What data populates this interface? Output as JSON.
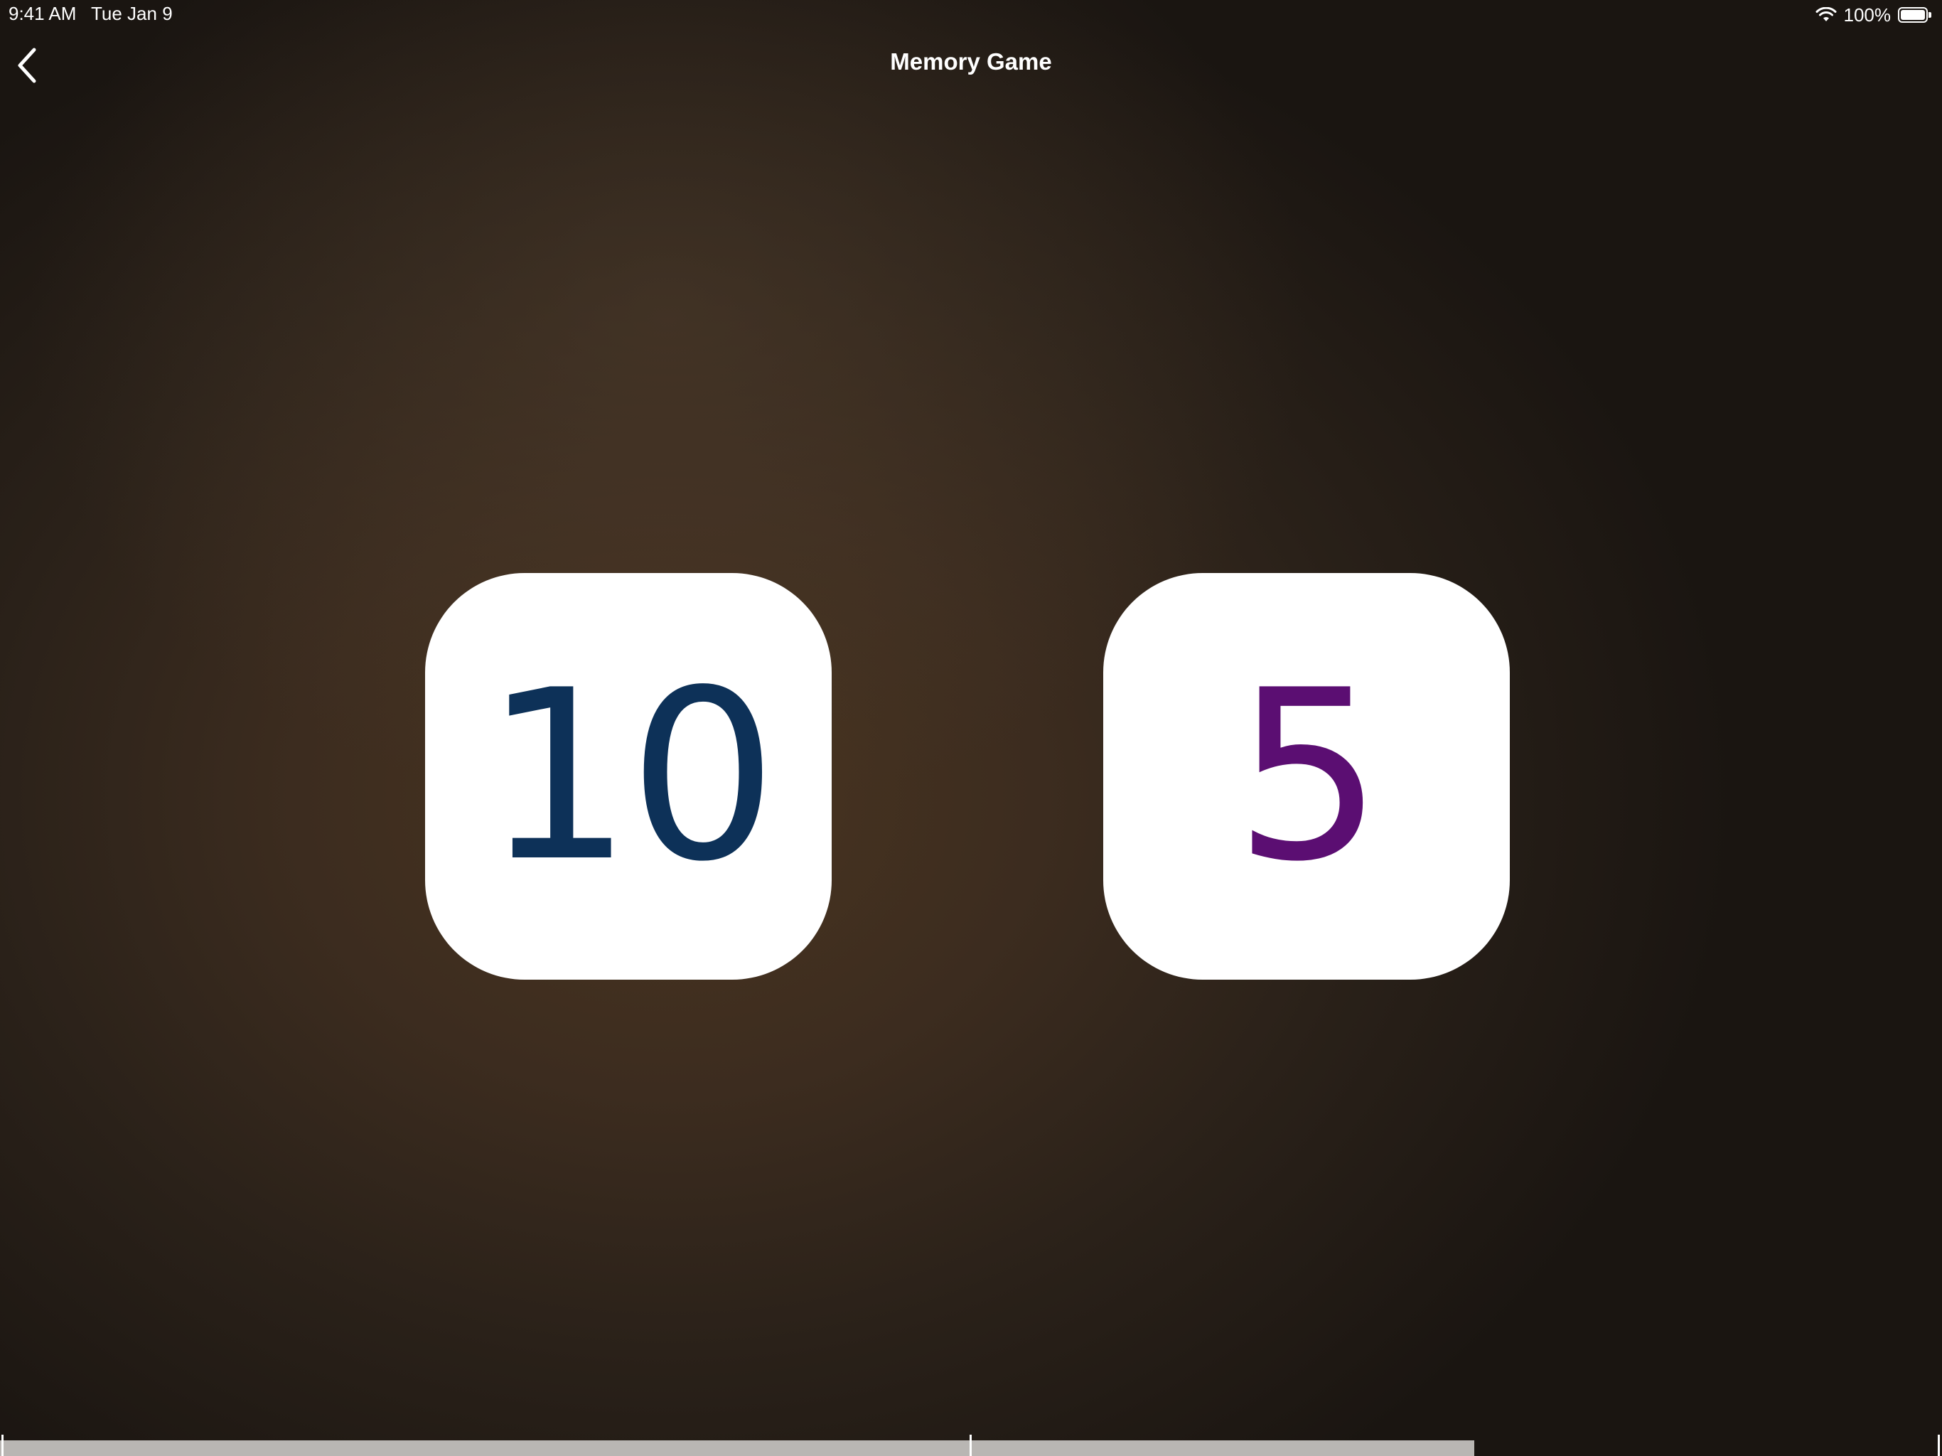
{
  "status_bar": {
    "time": "9:41 AM",
    "date": "Tue Jan 9",
    "battery": "100%"
  },
  "nav": {
    "title": "Memory Game",
    "back_icon": "chevron-left-icon"
  },
  "cards": [
    {
      "value": "10",
      "color": "#0d3158"
    },
    {
      "value": "5",
      "color": "#5b0e72"
    }
  ],
  "colors": {
    "background": "#3c2c1f",
    "card": "#ffffff",
    "progress_track": "#b9b6b3"
  }
}
